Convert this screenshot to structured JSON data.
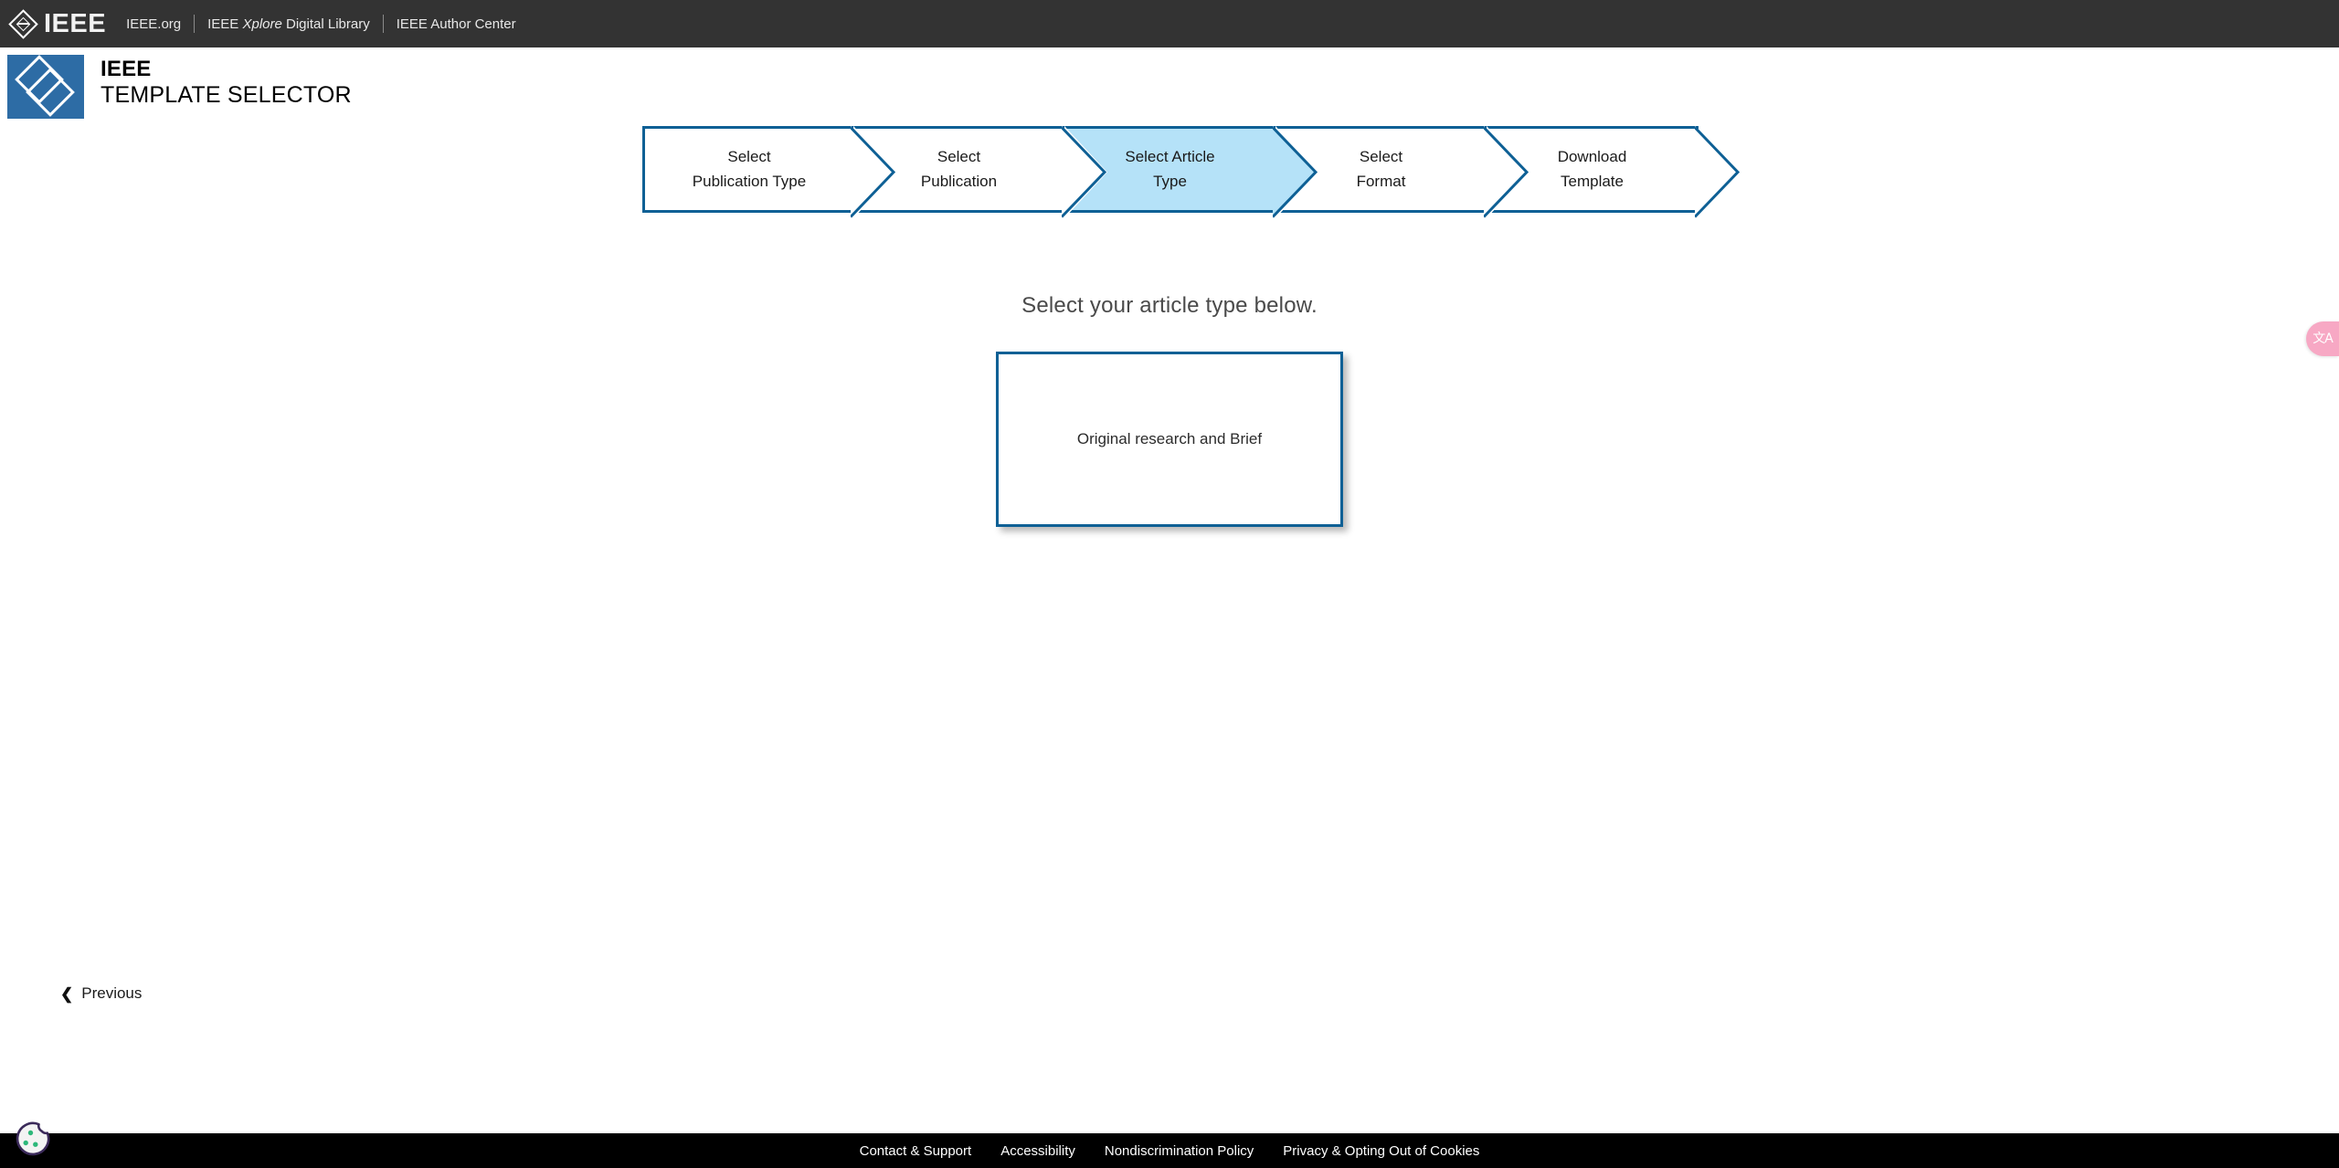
{
  "topbar": {
    "logo_alt": "IEEE",
    "wordmark": "IEEE",
    "links": [
      {
        "label": "IEEE.org"
      },
      {
        "label_prefix": "IEEE ",
        "label_italic": "Xplore",
        "label_suffix": " Digital Library",
        "label": "IEEE Xplore Digital Library"
      },
      {
        "label": "IEEE Author Center"
      }
    ]
  },
  "brand": {
    "title": "IEEE",
    "subtitle": "TEMPLATE SELECTOR",
    "tile_color": "#2d6ca5"
  },
  "stepper": {
    "active_index": 2,
    "active_fill": "#b5e2f8",
    "border_color": "#0e6095",
    "steps": [
      {
        "line1": "Select",
        "line2": "Publication Type",
        "state": "complete"
      },
      {
        "line1": "Select",
        "line2": "Publication",
        "state": "complete"
      },
      {
        "line1": "Select Article",
        "line2": "Type",
        "state": "active"
      },
      {
        "line1": "Select",
        "line2": "Format",
        "state": "upcoming"
      },
      {
        "line1": "Download",
        "line2": "Template",
        "state": "upcoming"
      }
    ]
  },
  "main": {
    "heading": "Select your article type below.",
    "article_types": [
      {
        "label": "Original research and Brief"
      }
    ]
  },
  "navigation": {
    "previous_label": "Previous",
    "previous_icon": "chevron-left-icon"
  },
  "footer": {
    "links": [
      {
        "label": "Contact & Support"
      },
      {
        "label": "Accessibility"
      },
      {
        "label": "Nondiscrimination Policy"
      },
      {
        "label": "Privacy & Opting Out of Cookies"
      }
    ]
  },
  "widgets": {
    "cookie_icon": "cookie-icon",
    "translate_tab": {
      "icon": "translate-icon",
      "glyph": "文A",
      "color": "#f7a8c4"
    }
  }
}
